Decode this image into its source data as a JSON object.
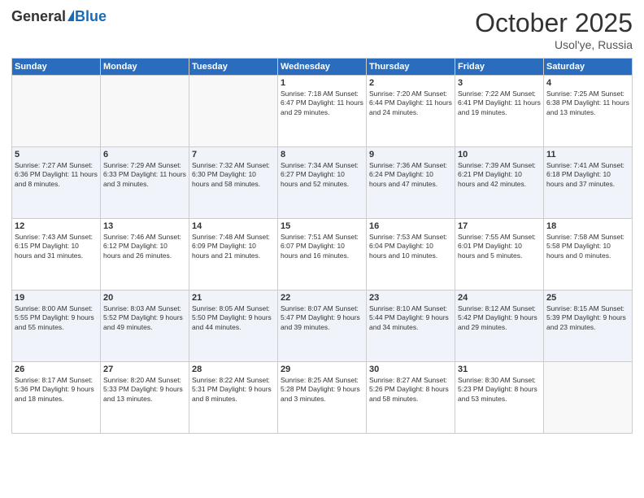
{
  "header": {
    "logo_general": "General",
    "logo_blue": "Blue",
    "month": "October 2025",
    "location": "Usol'ye, Russia"
  },
  "days_of_week": [
    "Sunday",
    "Monday",
    "Tuesday",
    "Wednesday",
    "Thursday",
    "Friday",
    "Saturday"
  ],
  "weeks": [
    [
      {
        "day": "",
        "content": ""
      },
      {
        "day": "",
        "content": ""
      },
      {
        "day": "",
        "content": ""
      },
      {
        "day": "1",
        "content": "Sunrise: 7:18 AM\nSunset: 6:47 PM\nDaylight: 11 hours\nand 29 minutes."
      },
      {
        "day": "2",
        "content": "Sunrise: 7:20 AM\nSunset: 6:44 PM\nDaylight: 11 hours\nand 24 minutes."
      },
      {
        "day": "3",
        "content": "Sunrise: 7:22 AM\nSunset: 6:41 PM\nDaylight: 11 hours\nand 19 minutes."
      },
      {
        "day": "4",
        "content": "Sunrise: 7:25 AM\nSunset: 6:38 PM\nDaylight: 11 hours\nand 13 minutes."
      }
    ],
    [
      {
        "day": "5",
        "content": "Sunrise: 7:27 AM\nSunset: 6:36 PM\nDaylight: 11 hours\nand 8 minutes."
      },
      {
        "day": "6",
        "content": "Sunrise: 7:29 AM\nSunset: 6:33 PM\nDaylight: 11 hours\nand 3 minutes."
      },
      {
        "day": "7",
        "content": "Sunrise: 7:32 AM\nSunset: 6:30 PM\nDaylight: 10 hours\nand 58 minutes."
      },
      {
        "day": "8",
        "content": "Sunrise: 7:34 AM\nSunset: 6:27 PM\nDaylight: 10 hours\nand 52 minutes."
      },
      {
        "day": "9",
        "content": "Sunrise: 7:36 AM\nSunset: 6:24 PM\nDaylight: 10 hours\nand 47 minutes."
      },
      {
        "day": "10",
        "content": "Sunrise: 7:39 AM\nSunset: 6:21 PM\nDaylight: 10 hours\nand 42 minutes."
      },
      {
        "day": "11",
        "content": "Sunrise: 7:41 AM\nSunset: 6:18 PM\nDaylight: 10 hours\nand 37 minutes."
      }
    ],
    [
      {
        "day": "12",
        "content": "Sunrise: 7:43 AM\nSunset: 6:15 PM\nDaylight: 10 hours\nand 31 minutes."
      },
      {
        "day": "13",
        "content": "Sunrise: 7:46 AM\nSunset: 6:12 PM\nDaylight: 10 hours\nand 26 minutes."
      },
      {
        "day": "14",
        "content": "Sunrise: 7:48 AM\nSunset: 6:09 PM\nDaylight: 10 hours\nand 21 minutes."
      },
      {
        "day": "15",
        "content": "Sunrise: 7:51 AM\nSunset: 6:07 PM\nDaylight: 10 hours\nand 16 minutes."
      },
      {
        "day": "16",
        "content": "Sunrise: 7:53 AM\nSunset: 6:04 PM\nDaylight: 10 hours\nand 10 minutes."
      },
      {
        "day": "17",
        "content": "Sunrise: 7:55 AM\nSunset: 6:01 PM\nDaylight: 10 hours\nand 5 minutes."
      },
      {
        "day": "18",
        "content": "Sunrise: 7:58 AM\nSunset: 5:58 PM\nDaylight: 10 hours\nand 0 minutes."
      }
    ],
    [
      {
        "day": "19",
        "content": "Sunrise: 8:00 AM\nSunset: 5:55 PM\nDaylight: 9 hours\nand 55 minutes."
      },
      {
        "day": "20",
        "content": "Sunrise: 8:03 AM\nSunset: 5:52 PM\nDaylight: 9 hours\nand 49 minutes."
      },
      {
        "day": "21",
        "content": "Sunrise: 8:05 AM\nSunset: 5:50 PM\nDaylight: 9 hours\nand 44 minutes."
      },
      {
        "day": "22",
        "content": "Sunrise: 8:07 AM\nSunset: 5:47 PM\nDaylight: 9 hours\nand 39 minutes."
      },
      {
        "day": "23",
        "content": "Sunrise: 8:10 AM\nSunset: 5:44 PM\nDaylight: 9 hours\nand 34 minutes."
      },
      {
        "day": "24",
        "content": "Sunrise: 8:12 AM\nSunset: 5:42 PM\nDaylight: 9 hours\nand 29 minutes."
      },
      {
        "day": "25",
        "content": "Sunrise: 8:15 AM\nSunset: 5:39 PM\nDaylight: 9 hours\nand 23 minutes."
      }
    ],
    [
      {
        "day": "26",
        "content": "Sunrise: 8:17 AM\nSunset: 5:36 PM\nDaylight: 9 hours\nand 18 minutes."
      },
      {
        "day": "27",
        "content": "Sunrise: 8:20 AM\nSunset: 5:33 PM\nDaylight: 9 hours\nand 13 minutes."
      },
      {
        "day": "28",
        "content": "Sunrise: 8:22 AM\nSunset: 5:31 PM\nDaylight: 9 hours\nand 8 minutes."
      },
      {
        "day": "29",
        "content": "Sunrise: 8:25 AM\nSunset: 5:28 PM\nDaylight: 9 hours\nand 3 minutes."
      },
      {
        "day": "30",
        "content": "Sunrise: 8:27 AM\nSunset: 5:26 PM\nDaylight: 8 hours\nand 58 minutes."
      },
      {
        "day": "31",
        "content": "Sunrise: 8:30 AM\nSunset: 5:23 PM\nDaylight: 8 hours\nand 53 minutes."
      },
      {
        "day": "",
        "content": ""
      }
    ]
  ]
}
